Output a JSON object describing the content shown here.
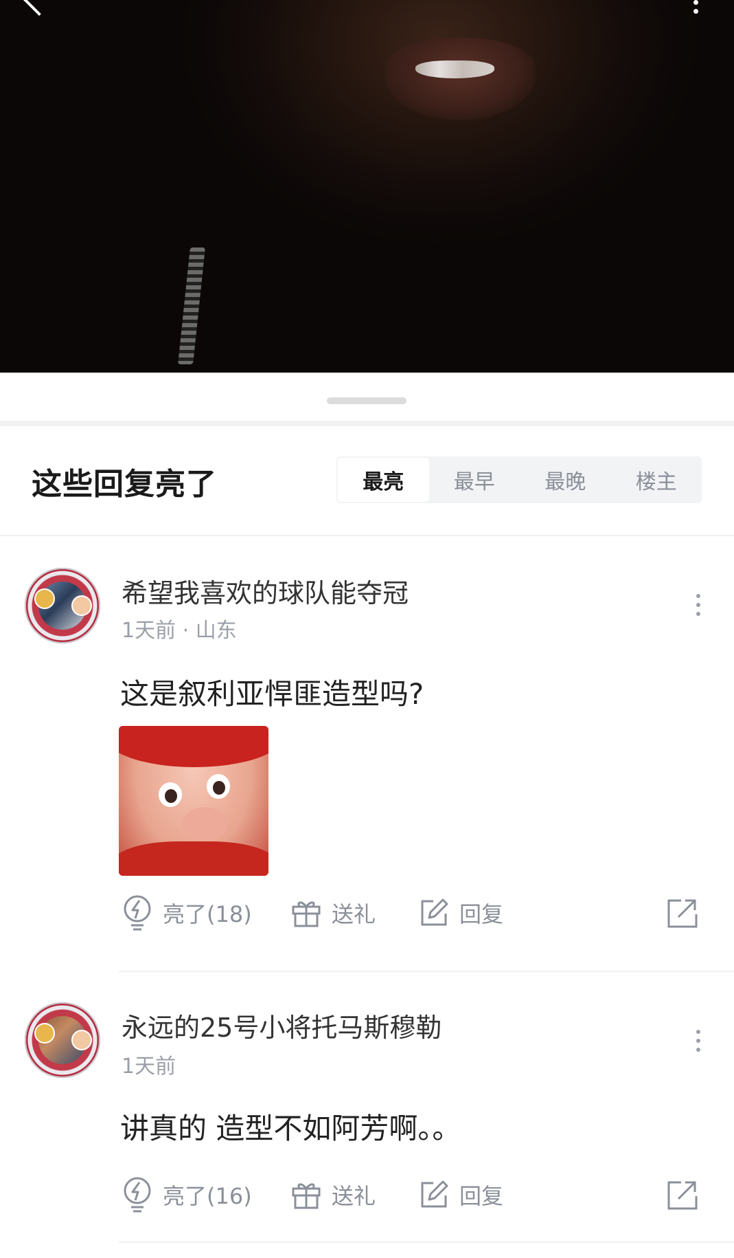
{
  "header": {
    "title": "这些回复亮了",
    "tabs": [
      {
        "label": "最亮",
        "active": true
      },
      {
        "label": "最早",
        "active": false
      },
      {
        "label": "最晚",
        "active": false
      },
      {
        "label": "楼主",
        "active": false
      }
    ]
  },
  "comments": [
    {
      "username": "希望我喜欢的球队能夺冠",
      "meta": "1天前 · 山东",
      "content": "这是叙利亚悍匪造型吗?",
      "has_sticker": true,
      "likes_label": "亮了(18)",
      "gift_label": "送礼",
      "reply_label": "回复"
    },
    {
      "username": "永远的25号小将托马斯穆勒",
      "meta": "1天前",
      "content": "讲真的 造型不如阿芳啊。。",
      "has_sticker": false,
      "likes_label": "亮了(16)",
      "gift_label": "送礼",
      "reply_label": "回复"
    }
  ],
  "colors": {
    "accent_text": "#1a1a1a",
    "muted_text": "#8a8f99",
    "tab_bg": "#f2f3f5"
  },
  "icons": [
    "back-icon",
    "more-icon",
    "light-bulb-icon",
    "gift-icon",
    "reply-edit-icon",
    "share-icon"
  ]
}
